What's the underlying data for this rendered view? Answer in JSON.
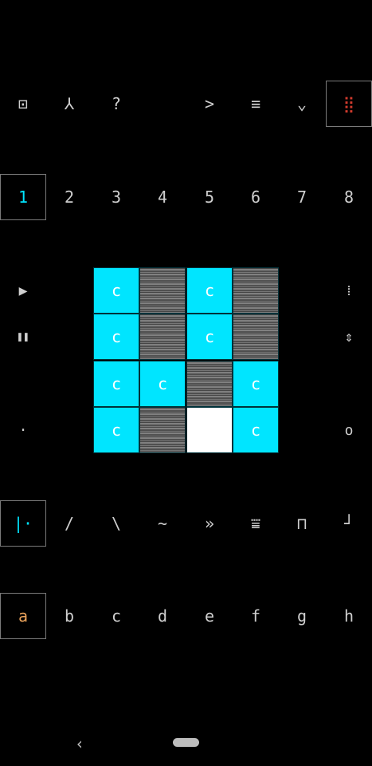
{
  "colors": {
    "accent": "#00e5ff",
    "letter_accent": "#e8a15a",
    "red_dots": "#d23b2d",
    "off": "#cfcfcf"
  },
  "top_toolbar": [
    {
      "icon": "square-icon",
      "glyph": "⊡"
    },
    {
      "icon": "wrench-icon",
      "glyph": "⅄"
    },
    {
      "icon": "question-icon",
      "glyph": "?"
    },
    {
      "icon": "empty",
      "glyph": ""
    },
    {
      "icon": "play-arrow-icon",
      "glyph": ">"
    },
    {
      "icon": "menu-icon",
      "glyph": "≡"
    },
    {
      "icon": "wave-icon",
      "glyph": "⌄"
    },
    {
      "icon": "grid-dots-icon",
      "glyph": "⣿"
    }
  ],
  "tracks": [
    "1",
    "2",
    "3",
    "4",
    "5",
    "6",
    "7",
    "8"
  ],
  "side_left": [
    {
      "icon": "play-icon",
      "glyph": "▶"
    },
    {
      "icon": "pause-icon",
      "glyph": "❚❚"
    },
    {
      "icon": "empty",
      "glyph": ""
    },
    {
      "icon": "dot-icon",
      "glyph": "·"
    }
  ],
  "side_right": [
    {
      "icon": "dots-icon",
      "glyph": "⁞"
    },
    {
      "icon": "updown-icon",
      "glyph": "⇕"
    },
    {
      "icon": "empty",
      "glyph": ""
    },
    {
      "icon": "circle-icon",
      "glyph": "o"
    }
  ],
  "pads": [
    [
      "c",
      "off",
      "c",
      "off"
    ],
    [
      "c",
      "off",
      "c",
      "off"
    ],
    [
      "c",
      "c",
      "off",
      "c"
    ],
    [
      "c",
      "off",
      "blank",
      "c"
    ]
  ],
  "waveforms": [
    {
      "icon": "step-icon",
      "glyph": "|·"
    },
    {
      "icon": "ramp-up-icon",
      "glyph": "/"
    },
    {
      "icon": "ramp-down-icon",
      "glyph": "\\"
    },
    {
      "icon": "sine-icon",
      "glyph": "~"
    },
    {
      "icon": "fast-forward-icon",
      "glyph": "»"
    },
    {
      "icon": "filter-icon",
      "glyph": "⩸"
    },
    {
      "icon": "square-wave-icon",
      "glyph": "⊓"
    },
    {
      "icon": "note-icon",
      "glyph": "┘"
    }
  ],
  "letters": [
    "a",
    "b",
    "c",
    "d",
    "e",
    "f",
    "g",
    "h"
  ],
  "nav": {
    "back": "‹"
  }
}
